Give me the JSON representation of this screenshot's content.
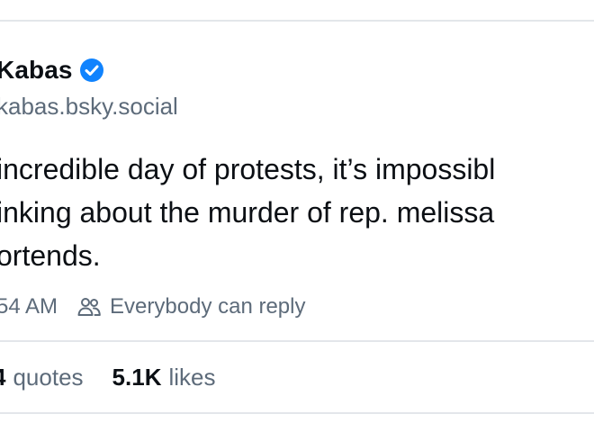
{
  "post": {
    "author": {
      "name": "Kabas",
      "verified": true,
      "verified_icon": "verified-check-icon",
      "handle": "kabas.bsky.social"
    },
    "text_lines": [
      "incredible day of protests, it’s impossibl",
      "inking about the murder of rep. melissa",
      "ortends."
    ],
    "time": "54 AM",
    "reply_setting": {
      "icon": "people-icon",
      "label": "Everybody can reply"
    },
    "stats": {
      "quotes_count": "4",
      "quotes_label": "quotes",
      "likes_count": "5.1K",
      "likes_label": "likes"
    }
  },
  "colors": {
    "text": "#0b0f14",
    "muted": "#5d6b7a",
    "divider": "#e3e6ea",
    "verified": "#1083fe"
  }
}
